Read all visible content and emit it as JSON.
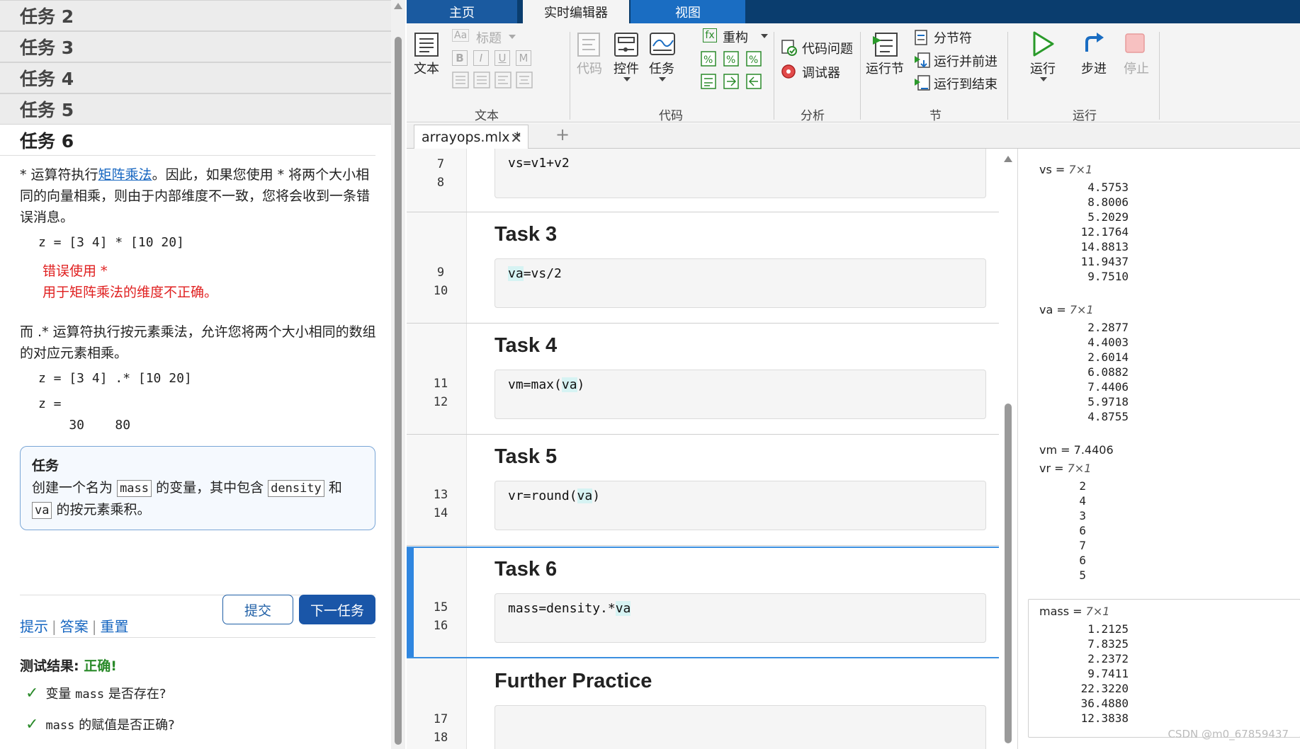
{
  "left": {
    "tasks_collapsed": [
      "任务 2",
      "任务 3",
      "任务 4",
      "任务 5"
    ],
    "active_task_title": "任务 6",
    "para1_a": "* 运算符执行",
    "para1_link": "矩阵乘法",
    "para1_b": "。因此，如果您使用 * 将两个大小相同的向量相乘，则由于内部维度不一致，您将会收到一条错误消息。",
    "code1": "z = [3 4] * [10 20]",
    "err1": "错误使用  *",
    "err2": "用于矩阵乘法的维度不正确。",
    "para2": "而 .* 运算符执行按元素乘法，允许您将两个大小相同的数组的对应元素相乘。",
    "code2": "z = [3 4] .* [10 20]",
    "code3": "z =",
    "code4": "    30    80",
    "taskbox": {
      "title": "任务",
      "t1": "创建一个名为",
      "chip1": "mass",
      "t2": "的变量，其中包含",
      "chip2": "density",
      "t3": "和",
      "chip3": "va",
      "t4": "的按元素乘积。"
    },
    "links": [
      "提示",
      "答案",
      "重置"
    ],
    "submit_label": "提交",
    "next_label": "下一任务",
    "result_label": "测试结果:",
    "result_value": "正确!",
    "checks": [
      {
        "a": "变量",
        "code": "mass",
        "b": "是否存在?"
      },
      {
        "a": "",
        "code": "mass",
        "b": "的赋值是否正确?"
      }
    ]
  },
  "matlab": {
    "tabs": {
      "home": "主页",
      "live": "实时编辑器",
      "view": "视图"
    },
    "ribbon": {
      "text_btn": "文本",
      "heading": "标题",
      "format_letters": [
        "B",
        "I",
        "U",
        "M"
      ],
      "section_text": "文本",
      "code_btn": "代码",
      "control_btn": "控件",
      "task_btn": "任务",
      "refactor": "重构",
      "section_code": "代码",
      "code_issues": "代码问题",
      "debugger": "调试器",
      "section_analyze": "分析",
      "run_section": "运行节",
      "section_break": "分节符",
      "run_advance": "运行并前进",
      "run_to_end": "运行到结束",
      "section_section": "节",
      "run": "运行",
      "step": "步进",
      "stop": "停止",
      "section_run": "运行"
    },
    "file_tab": "arrayops.mlx *",
    "sections": [
      {
        "title": "",
        "lines": [
          "7",
          "8"
        ],
        "code": "vs=v1+v2"
      },
      {
        "title": "Task 3",
        "lines": [
          "9",
          "10"
        ],
        "code_a": "",
        "code_hl": "va",
        "code_b": "=vs/2"
      },
      {
        "title": "Task 4",
        "lines": [
          "11",
          "12"
        ],
        "code_a": "vm=max(",
        "code_hl": "va",
        "code_b": ")"
      },
      {
        "title": "Task 5",
        "lines": [
          "13",
          "14"
        ],
        "code_a": "vr=round(",
        "code_hl": "va",
        "code_b": ")"
      },
      {
        "title": "Task 6",
        "lines": [
          "15",
          "16"
        ],
        "code_a": "mass=density.*",
        "code_hl": "va",
        "code_b": ""
      },
      {
        "title": "Further Practice",
        "lines": [
          "17",
          "18"
        ],
        "code": ""
      }
    ],
    "outputs": {
      "vs": {
        "head": "vs = ",
        "dim": "7×1",
        "values": [
          "4.5753",
          "8.8006",
          "5.2029",
          "12.1764",
          "14.8813",
          "11.9437",
          "9.7510"
        ]
      },
      "va": {
        "head": "va = ",
        "dim": "7×1",
        "values": [
          "2.2877",
          "4.4003",
          "2.6014",
          "6.0882",
          "7.4406",
          "5.9718",
          "4.8755"
        ]
      },
      "vm": {
        "head": "vm = 7.4406"
      },
      "vr": {
        "head": "vr = ",
        "dim": "7×1",
        "values": [
          "2",
          "4",
          "3",
          "6",
          "7",
          "6",
          "5"
        ]
      },
      "mass": {
        "head": "mass = ",
        "dim": "7×1",
        "values": [
          "1.2125",
          "7.8325",
          "2.2372",
          "9.7411",
          "22.3220",
          "36.4880",
          "12.3838"
        ]
      }
    },
    "watermark": "CSDN @m0_67859437"
  },
  "colors": {
    "tab_dark": "#0a3d6e",
    "accent_blue": "#1a56a8",
    "ok_green": "#2a8a2a",
    "error_red": "#e02020",
    "active_section": "#2f86e0"
  }
}
